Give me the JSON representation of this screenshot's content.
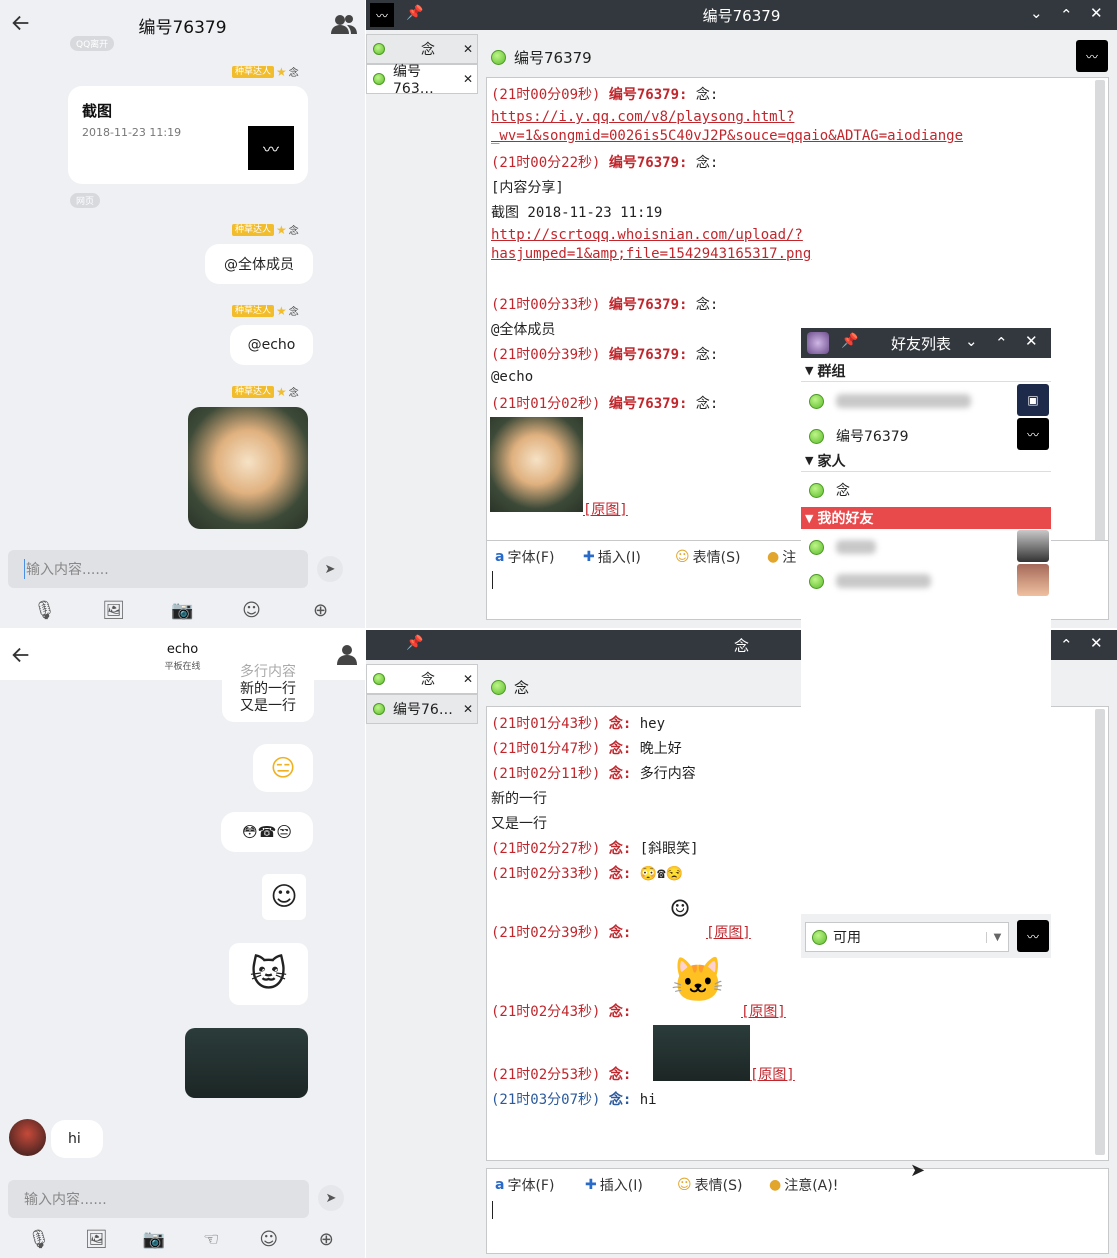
{
  "top_mobile": {
    "title": "编号76379",
    "status_pill": "QQ离开",
    "tag_label": "种草达人",
    "sender": "念",
    "card": {
      "title": "截图",
      "date": "2018-11-23 11:19"
    },
    "web_pill": "网页",
    "msg1": "@全体成员",
    "msg2": "@echo",
    "input_placeholder": "输入内容......"
  },
  "bottom_mobile": {
    "title": "echo",
    "subtitle": "平板在线",
    "multiline": [
      "多行内容",
      "新的一行",
      "又是一行"
    ],
    "hi": "hi",
    "input_placeholder": "输入内容......"
  },
  "win1": {
    "title": "编号76379",
    "tabs": [
      {
        "label": "念"
      },
      {
        "label": "编号763…"
      }
    ],
    "header_name": "编号76379",
    "lines": [
      {
        "ts": "(21时00分09秒)",
        "name": "编号76379:",
        "text": "念:"
      },
      {
        "link1": "https://i.y.qq.com/v8/playsong.html?",
        "link2": "_wv=1&songmid=0026is5C40vJ2P&souce=qqaio&ADTAG=aiodiange"
      },
      {
        "ts": "(21时00分22秒)",
        "name": "编号76379:",
        "text": "念:"
      },
      {
        "text": "[内容分享]"
      },
      {
        "text": "截图 2018-11-23 11:19"
      },
      {
        "link1": "http://scrtoqq.whoisnian.com/upload/?",
        "link2": "hasjumped=1&amp;file=1542943165317.png"
      },
      {
        "ts": "(21时00分33秒)",
        "name": "编号76379:",
        "text": "念:"
      },
      {
        "text": "@全体成员"
      },
      {
        "ts": "(21时00分39秒)",
        "name": "编号76379:",
        "text": "念:"
      },
      {
        "text": "@echo"
      },
      {
        "ts": "(21时01分02秒)",
        "name": "编号76379:",
        "text": "念:"
      }
    ],
    "orig": "[原图]",
    "toolbar": {
      "font": "字体(F)",
      "insert": "插入(I)",
      "emoji": "表情(S)",
      "attn": "注"
    }
  },
  "friends": {
    "title": "好友列表",
    "groups": [
      {
        "label": "群组",
        "items": [
          "",
          "编号76379"
        ]
      },
      {
        "label": "家人",
        "items": [
          "念"
        ]
      },
      {
        "label": "我的好友",
        "items": [
          "",
          ""
        ]
      }
    ],
    "status": "可用"
  },
  "win2": {
    "title": "念",
    "tabs": [
      {
        "label": "念"
      },
      {
        "label": "编号76…"
      }
    ],
    "header_name": "念",
    "lines": [
      {
        "ts": "(21时01分43秒)",
        "name": "念:",
        "text": "hey"
      },
      {
        "ts": "(21时01分47秒)",
        "name": "念:",
        "text": "晚上好"
      },
      {
        "ts": "(21时02分11秒)",
        "name": "念:",
        "text": "多行内容"
      },
      {
        "text": "新的一行"
      },
      {
        "text": "又是一行"
      },
      {
        "ts": "(21时02分27秒)",
        "name": "念:",
        "text": "[斜眼笑]"
      },
      {
        "ts": "(21时02分33秒)",
        "name": "念:",
        "text": "😳☎😒"
      },
      {
        "ts": "(21时02分39秒)",
        "name": "念:"
      },
      {
        "ts": "(21时02分43秒)",
        "name": "念:"
      },
      {
        "ts": "(21时02分53秒)",
        "name": "念:"
      },
      {
        "ts": "(21时03分07秒)",
        "name": "念:",
        "text": "hi"
      }
    ],
    "orig": "[原图]",
    "toolbar": {
      "font": "字体(F)",
      "insert": "插入(I)",
      "emoji": "表情(S)",
      "attn": "注意(A)!"
    }
  }
}
